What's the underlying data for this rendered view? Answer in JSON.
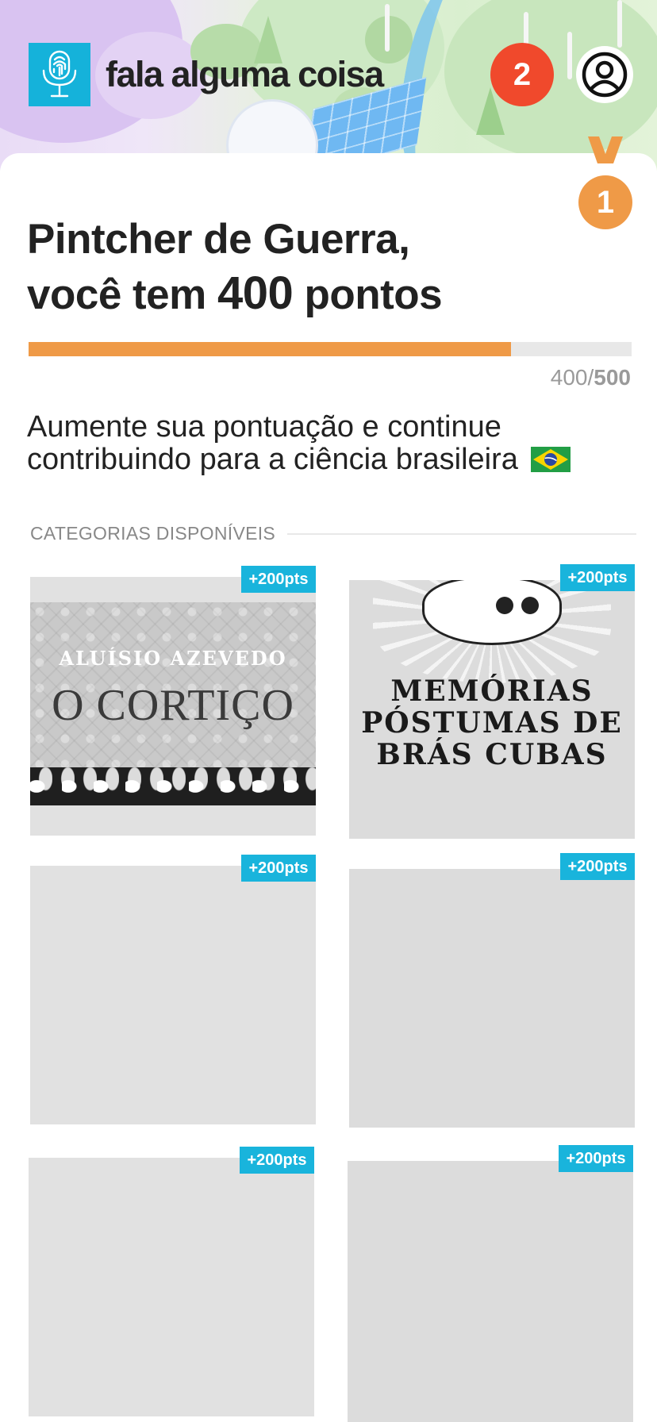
{
  "app": {
    "title": "fala alguma coisa",
    "logo_icon": "mic-fingerprint-icon",
    "notification_count": "2",
    "profile_icon": "user-circle-icon"
  },
  "medal": {
    "rank": "1",
    "color": "#ef9a47"
  },
  "summary": {
    "user_name": "Pintcher de Guerra,",
    "points_prefix": "você tem",
    "points": "400",
    "points_suffix": "pontos",
    "progress_current": "400",
    "progress_separator": "/",
    "progress_goal": "500",
    "progress_fraction": 0.8,
    "message": "Aumente sua pontuação e continue contribuindo para a ciência brasileira",
    "flag_icon": "brazil-flag-icon"
  },
  "categories": {
    "section_title": "CATEGORIAS DISPONÍVEIS",
    "items": [
      {
        "badge": "+200pts",
        "cover_author": "ALUÍSIO AZEVEDO",
        "cover_title": "O CORTIÇO"
      },
      {
        "badge": "+200pts",
        "cover_title": "MEMÓRIAS\nPÓSTUMAS DE\nBRÁS CUBAS"
      },
      {
        "badge": "+200pts"
      },
      {
        "badge": "+200pts"
      },
      {
        "badge": "+200pts"
      },
      {
        "badge": "+200pts"
      }
    ]
  },
  "colors": {
    "accent_blue": "#19b4dc",
    "notification_red": "#f0492c",
    "progress_orange": "#ef9a47"
  }
}
